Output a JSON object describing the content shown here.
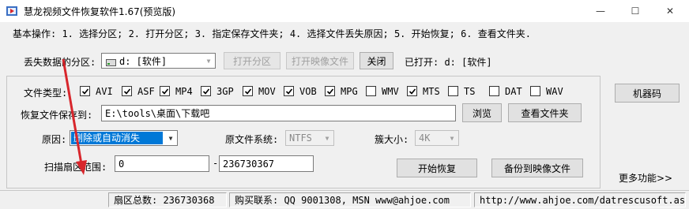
{
  "window": {
    "title": "慧龙视频文件恢复软件1.67(预览版)",
    "minimize_glyph": "—",
    "maximize_glyph": "☐",
    "close_glyph": "✕"
  },
  "instructions": "基本操作: 1. 选择分区; 2. 打开分区; 3. 指定保存文件夹; 4. 选择文件丢失原因; 5. 开始恢复; 6. 查看文件夹.",
  "source": {
    "label": "丢失数据的分区:",
    "drive_value": "d: [软件]",
    "open_partition": "打开分区",
    "open_image": "打开映像文件",
    "close": "关闭",
    "opened_label": "已打开: d: [软件]"
  },
  "file_types": {
    "label": "文件类型:",
    "items": [
      {
        "label": "AVI",
        "checked": true
      },
      {
        "label": "ASF",
        "checked": true
      },
      {
        "label": "MP4",
        "checked": true
      },
      {
        "label": "3GP",
        "checked": true
      },
      {
        "label": "MOV",
        "checked": true
      },
      {
        "label": "VOB",
        "checked": true
      },
      {
        "label": "MPG",
        "checked": true
      },
      {
        "label": "WMV",
        "checked": false
      },
      {
        "label": "MTS",
        "checked": true
      },
      {
        "label": "TS",
        "checked": false
      },
      {
        "label": "DAT",
        "checked": false
      },
      {
        "label": "WAV",
        "checked": false
      }
    ]
  },
  "save": {
    "label": "恢复文件保存到:",
    "path": "E:\\tools\\桌面\\下载吧",
    "browse": "浏览",
    "view_folder": "查看文件夹"
  },
  "reason": {
    "label": "原因:",
    "value": "删除或自动消失"
  },
  "fs": {
    "label": "原文件系统:",
    "value": "NTFS"
  },
  "cluster": {
    "label": "簇大小:",
    "value": "4K"
  },
  "range": {
    "label": "扫描扇区范围:",
    "start": "0",
    "dash": "-",
    "end": "236730367",
    "start_recovery": "开始恢复",
    "backup_image": "备份到映像文件"
  },
  "side": {
    "machine_code": "机器码",
    "more": "更多功能>>"
  },
  "status": {
    "sectors": "扇区总数: 236730368",
    "contact": "购买联系: QQ 9001308, MSN www@ahjoe.com",
    "url": "http://www.ahjoe.com/datrescusoft.asp"
  },
  "colors": {
    "selection": "#0078d7",
    "annotation_arrow": "#d8262c"
  }
}
